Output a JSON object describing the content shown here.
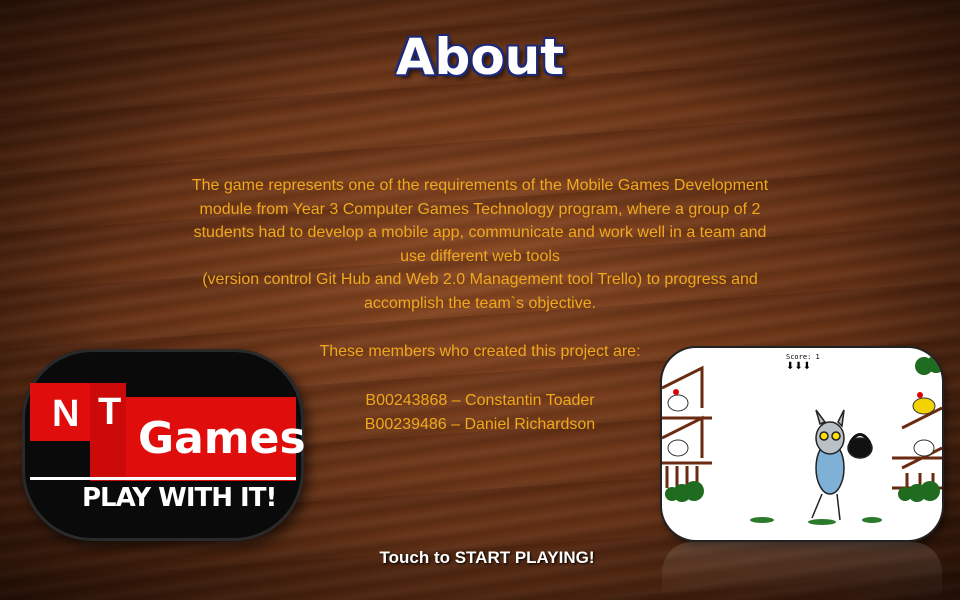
{
  "page": {
    "title": "About",
    "description_lines": [
      "The game represents one of the requirements of the Mobile Games Development",
      "module from Year 3 Computer Games Technology program, where a group of 2",
      "students had to develop a mobile app, communicate and work well in a team and",
      "use different web tools",
      "(version control Git Hub and Web 2.0 Management tool Trello) to progress and",
      "accomplish the team`s objective."
    ],
    "members_heading": "These members who created this project are:",
    "members": [
      "B00243868 – Constantin Toader",
      "B00239486 – Daniel Richardson"
    ],
    "start_prompt": "Touch to START PLAYING!"
  },
  "logo": {
    "letter_n": "N",
    "letter_t": "T",
    "brand": "Games",
    "tagline": "PLAY WITH IT!"
  },
  "preview": {
    "score_label": "Score: 1",
    "lives": "⬇⬇⬇"
  },
  "colors": {
    "text_orange": "#f0a81c",
    "title_outline": "#1d2a78",
    "logo_red": "#e00d0d"
  }
}
